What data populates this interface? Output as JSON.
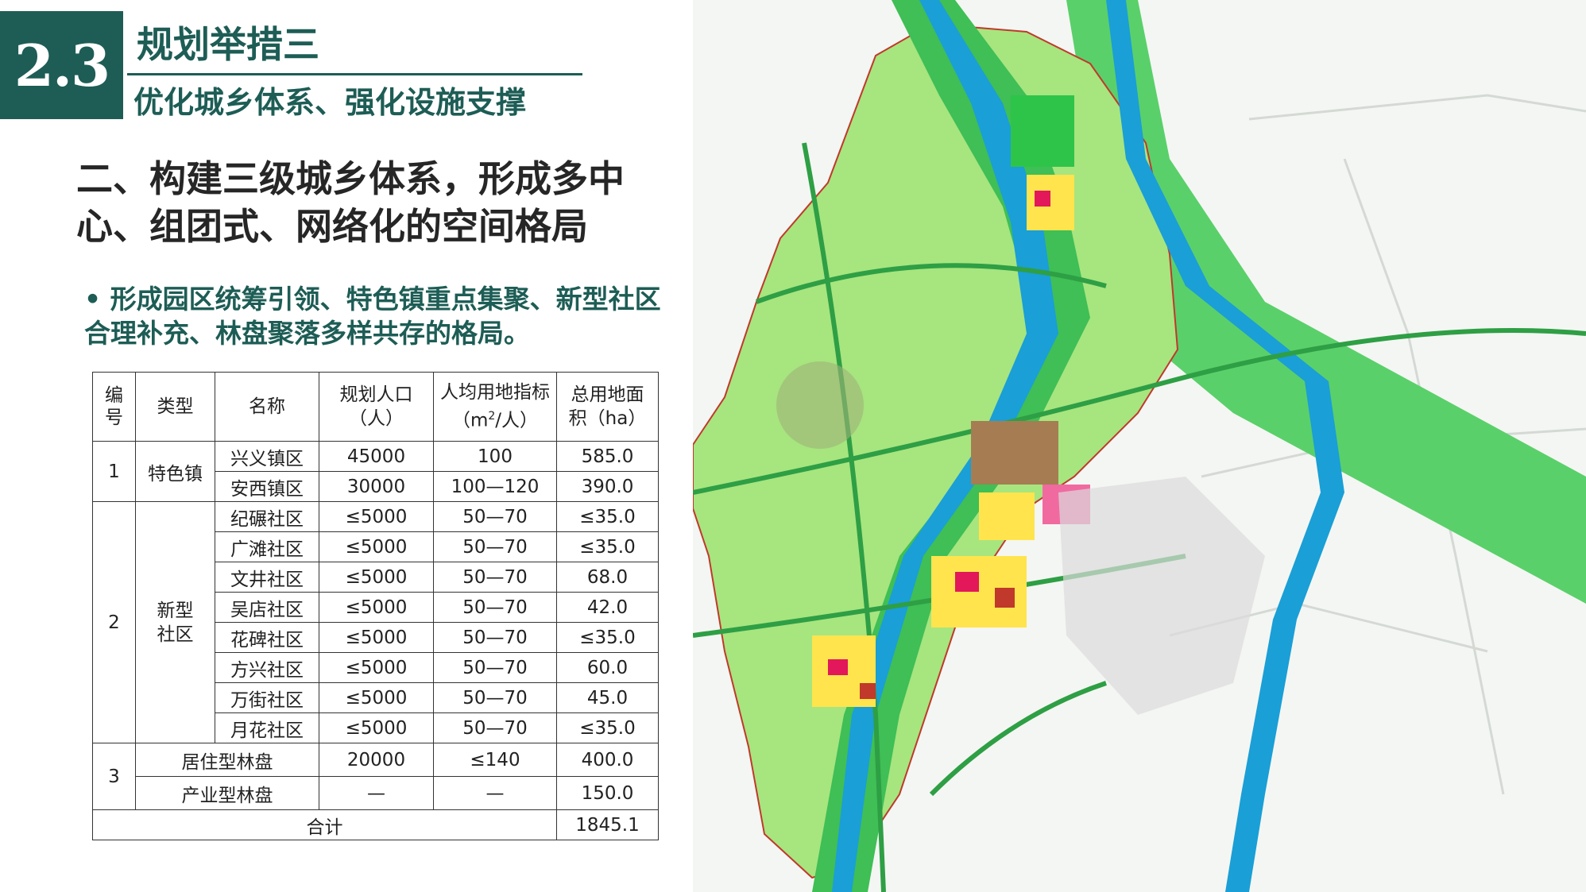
{
  "header": {
    "section_number": "2.3",
    "title": "规划举措三",
    "subtitle": "优化城乡体系、强化设施支撑"
  },
  "heading": "二、构建三级城乡体系，形成多中心、组团式、网络化的空间格局",
  "bullet": "• 形成园区统筹引领、特色镇重点集聚、新型社区合理补充、林盘聚落多样共存的格局。",
  "table": {
    "headers": {
      "no": "编号",
      "type": "类型",
      "name": "名称",
      "pop": "规划人口（人）",
      "per_cap_a": "人均用地指标（m",
      "per_cap_sup": "2",
      "per_cap_b": "/人）",
      "area": "总用地面积（ha）"
    },
    "groups": [
      {
        "no": "1",
        "type": "特色镇"
      },
      {
        "no": "2",
        "type": "新型社区"
      },
      {
        "no": "3"
      }
    ],
    "rows": [
      {
        "name": "兴义镇区",
        "pop": "45000",
        "per": "100",
        "area": "585.0"
      },
      {
        "name": "安西镇区",
        "pop": "30000",
        "per": "100—120",
        "area": "390.0"
      },
      {
        "name": "纪碾社区",
        "pop": "≤5000",
        "per": "50—70",
        "area": "≤35.0"
      },
      {
        "name": "广滩社区",
        "pop": "≤5000",
        "per": "50—70",
        "area": "≤35.0"
      },
      {
        "name": "文井社区",
        "pop": "≤5000",
        "per": "50—70",
        "area": "68.0"
      },
      {
        "name": "吴店社区",
        "pop": "≤5000",
        "per": "50—70",
        "area": "42.0"
      },
      {
        "name": "花碑社区",
        "pop": "≤5000",
        "per": "50—70",
        "area": "≤35.0"
      },
      {
        "name": "方兴社区",
        "pop": "≤5000",
        "per": "50—70",
        "area": "60.0"
      },
      {
        "name": "万街社区",
        "pop": "≤5000",
        "per": "50—70",
        "area": "45.0"
      },
      {
        "name": "月花社区",
        "pop": "≤5000",
        "per": "50—70",
        "area": "≤35.0"
      },
      {
        "name": "居住型林盘",
        "pop": "20000",
        "per": "≤140",
        "area": "400.0"
      },
      {
        "name": "产业型林盘",
        "pop": "—",
        "per": "—",
        "area": "150.0"
      }
    ],
    "total": {
      "label": "合计",
      "area": "1845.1"
    }
  },
  "colors": {
    "brand_green": "#1d5d55",
    "map_land": "#a7e57f",
    "map_river": "#1a9fd6",
    "map_buffer": "#5ad06a"
  }
}
